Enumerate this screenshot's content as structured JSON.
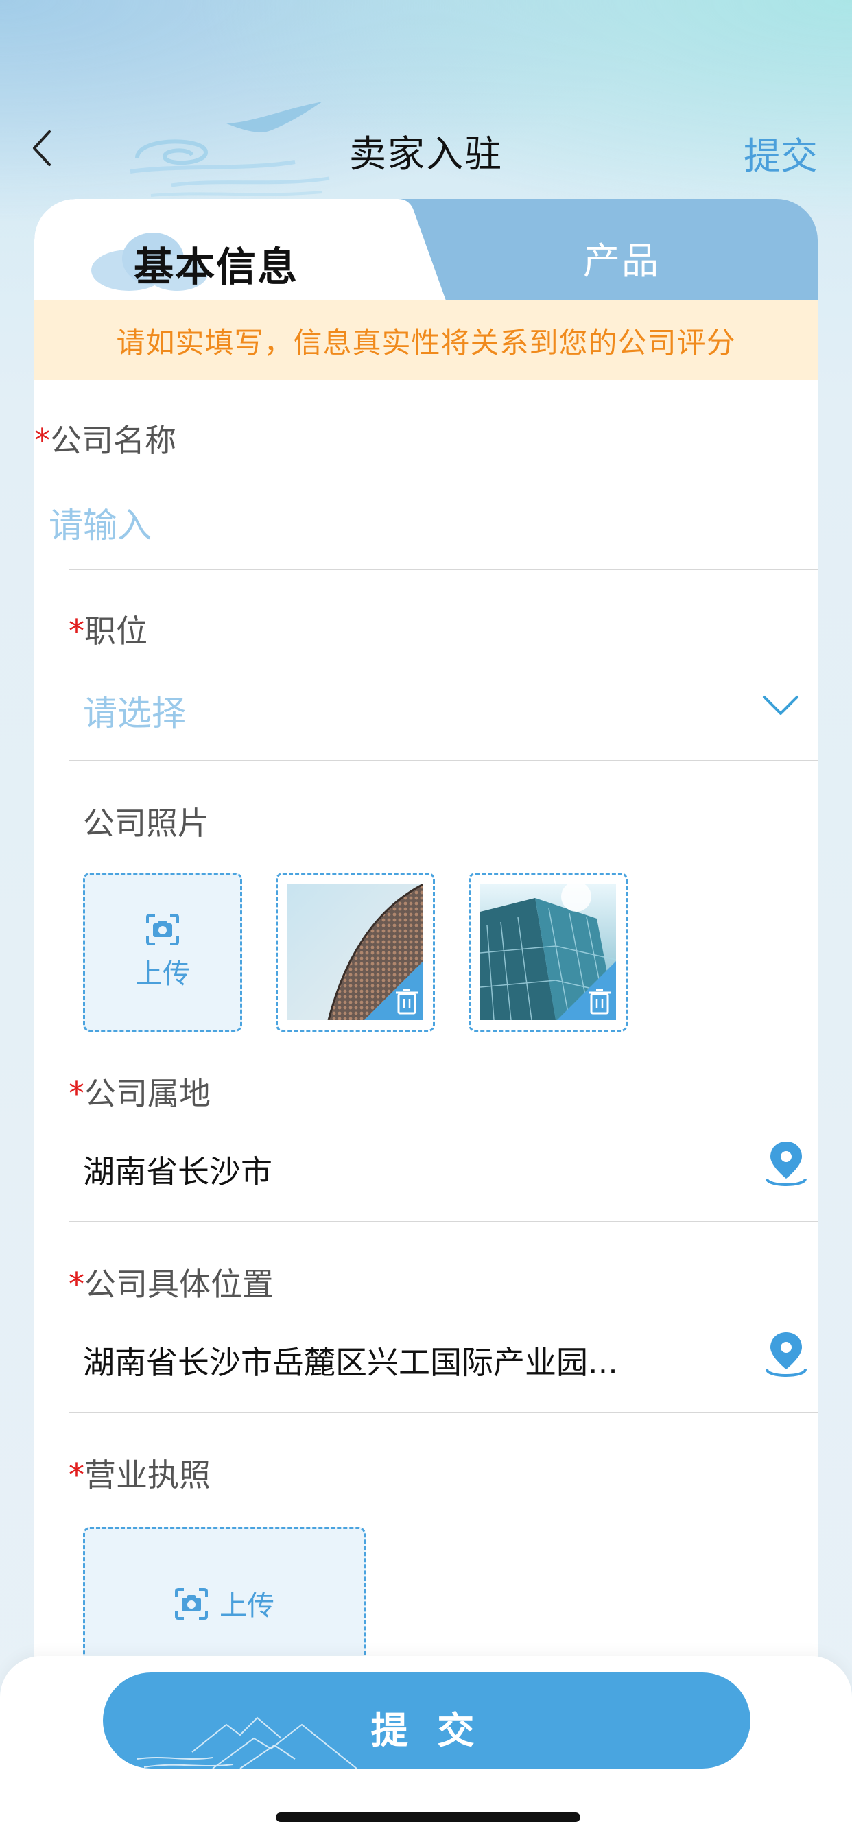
{
  "nav": {
    "title": "卖家入驻",
    "submit_label": "提交"
  },
  "tabs": [
    {
      "label": "基本信息",
      "active": true
    },
    {
      "label": "产品",
      "active": false
    }
  ],
  "notice": "请如实填写，信息真实性将关系到您的公司评分",
  "form": {
    "company_name": {
      "required_mark": "*",
      "label": "公司名称",
      "placeholder": "请输入"
    },
    "position": {
      "required_mark": "*",
      "label": "职位",
      "placeholder": "请选择"
    },
    "company_photos": {
      "label": "公司照片",
      "upload_label": "上传",
      "photo_count": 2
    },
    "company_location": {
      "required_mark": "*",
      "label": "公司属地",
      "value": "湖南省长沙市"
    },
    "company_address": {
      "required_mark": "*",
      "label": "公司具体位置",
      "value": "湖南省长沙市岳麓区兴工国际产业园..."
    },
    "business_license": {
      "required_mark": "*",
      "label": "营业执照",
      "upload_label": "上传"
    }
  },
  "footer": {
    "submit_label": "提 交"
  },
  "colors": {
    "accent": "#4a9fdb",
    "tab_inactive": "#8bbde1",
    "notice_bg": "#fff0d6",
    "notice_text": "#f08a1c",
    "required": "#e11e1e"
  },
  "icons": [
    "back-icon",
    "chevron-down-icon",
    "camera-icon",
    "trash-icon",
    "location-pin-icon"
  ]
}
